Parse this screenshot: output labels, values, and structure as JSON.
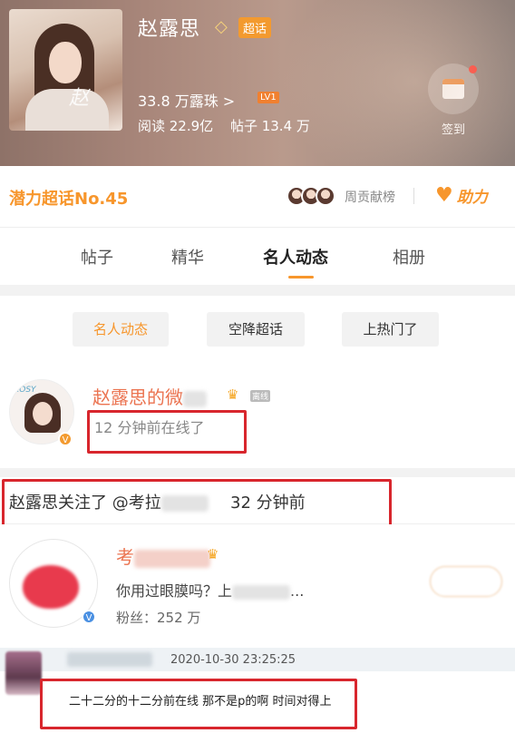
{
  "header": {
    "name": "赵露思",
    "badge_label": "超话",
    "fans": "33.8 万露珠 >",
    "level": "LV1",
    "reads": "阅读 22.9亿",
    "posts": "帖子 13.4 万",
    "checkin_label": "签到",
    "cover_script": "赵"
  },
  "potential": {
    "rank": "潜力超话No.45",
    "contrib": "周贡献榜",
    "boost": "助力"
  },
  "tabs": [
    "帖子",
    "精华",
    "名人动态",
    "相册"
  ],
  "filters": [
    "名人动态",
    "空降超话",
    "上热门了"
  ],
  "celebrity": {
    "name": "赵露思的微",
    "verified": "V",
    "status_tag": "离线",
    "online_text": "12 分钟前在线了",
    "avatar_text": "ROSY"
  },
  "follow": {
    "text": "赵露思关注了 @考拉",
    "time": "32 分钟前"
  },
  "user": {
    "name": "考",
    "intro": "你用过眼膜吗？上",
    "intro_end": "...",
    "fans": "粉丝：252 万",
    "verified": "V"
  },
  "comment": {
    "date": "2020-10-30 23:25:25",
    "text": "二十二分的十二分前在线 那不是p的啊 时间对得上"
  },
  "colors": {
    "accent": "#f7962c",
    "name": "#eb7350",
    "highlight_box": "#d8262d"
  }
}
